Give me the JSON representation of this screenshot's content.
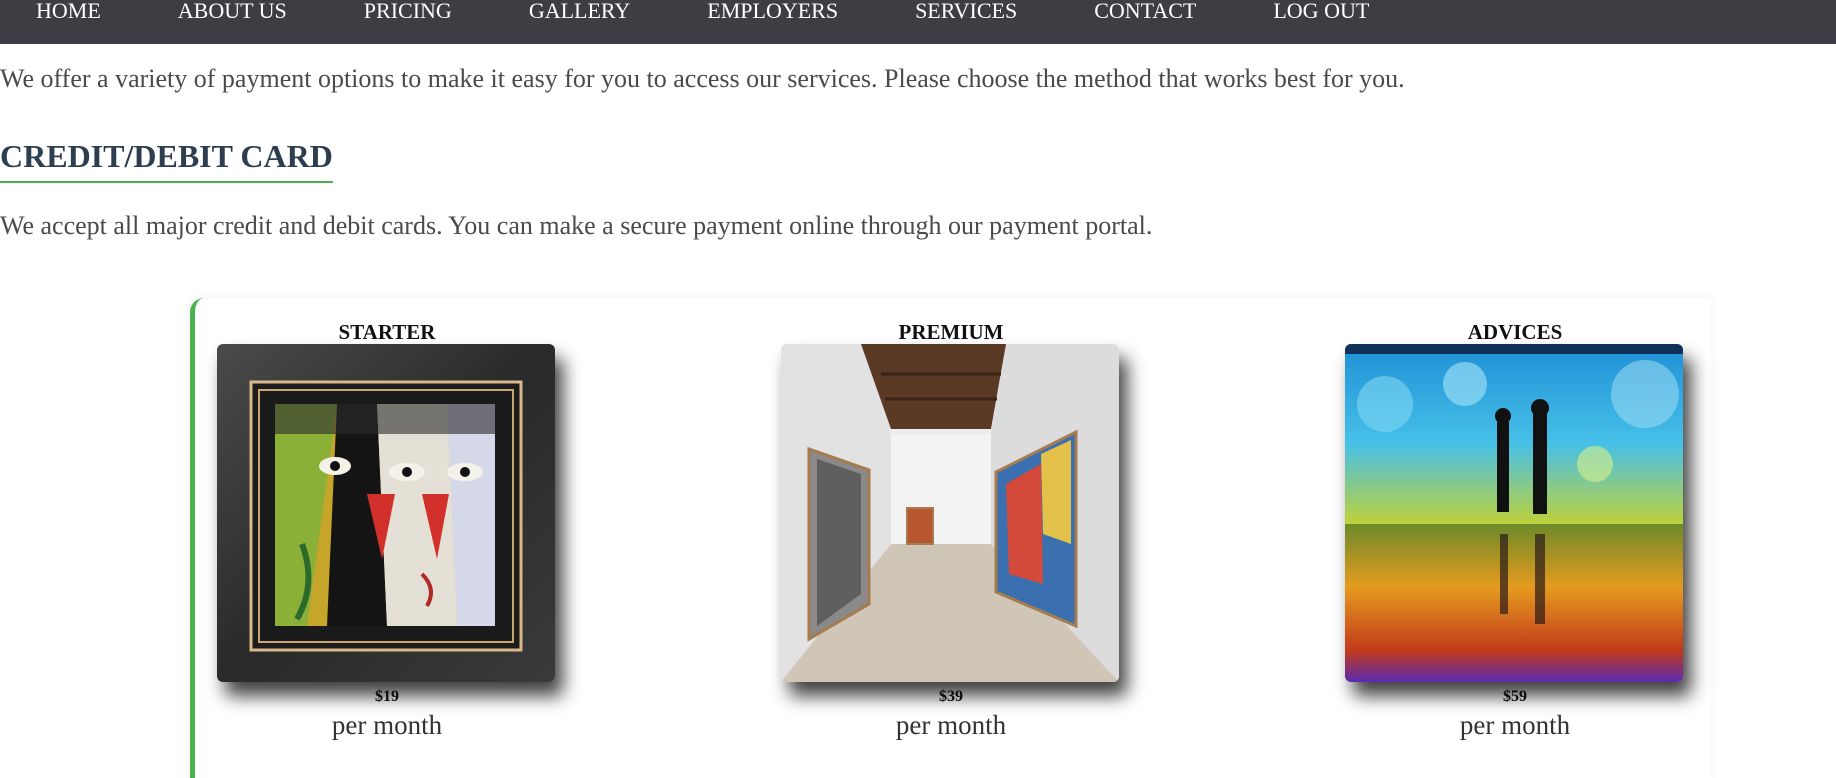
{
  "nav": {
    "items": [
      "HOME",
      "ABOUT US",
      "PRICING",
      "GALLERY",
      "EMPLOYERS",
      "SERVICES",
      "CONTACT",
      "LOG OUT"
    ]
  },
  "intro": "We offer a variety of payment options to make it easy for you to access our services. Please choose the method that works best for you.",
  "card_section": {
    "title": "CREDIT/DEBIT CARD",
    "text": "We accept all major credit and debit cards. You can make a secure payment online through our payment portal."
  },
  "plans": [
    {
      "name": "STARTER",
      "price": "$19",
      "period": "per month",
      "image": "framed-abstract-faces-painting"
    },
    {
      "name": "PREMIUM",
      "price": "$39",
      "period": "per month",
      "image": "white-gallery-hallway"
    },
    {
      "name": "ADVICES",
      "price": "$59",
      "period": "per month",
      "image": "immersive-digital-art-room"
    }
  ],
  "colors": {
    "nav_bg": "#3d3d44",
    "accent": "#4caf50",
    "heading": "#2c3e50"
  }
}
